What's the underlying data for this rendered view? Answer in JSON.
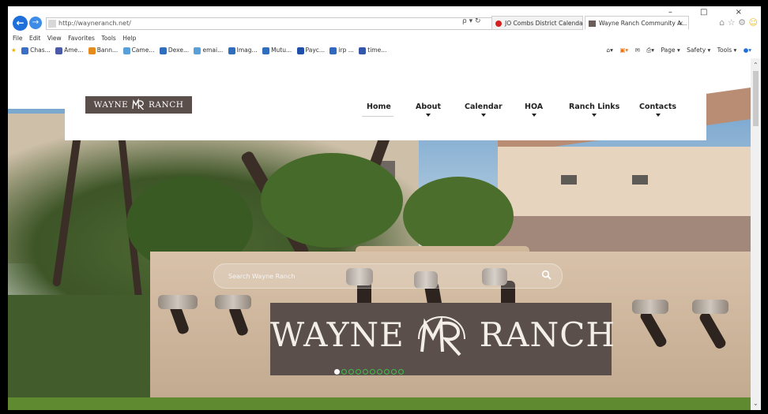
{
  "browser": {
    "address_url": "http://wayneranch.net/",
    "addr_tools": "ρ ▾ ↻",
    "tabs": [
      {
        "label": "JO Combs District Calendar",
        "active": false
      },
      {
        "label": "Wayne Ranch Community A...",
        "active": true,
        "close": "×"
      }
    ],
    "window_controls": "– □ ×",
    "menu": [
      "File",
      "Edit",
      "View",
      "Favorites",
      "Tools",
      "Help"
    ],
    "favorites": [
      "Chas...",
      "Ame...",
      "Bann...",
      "Came...",
      "Dexe...",
      "emai...",
      "Imag...",
      "Mutu...",
      "Payc...",
      "irp ...",
      "time..."
    ],
    "command_bar": [
      "Page ▾",
      "Safety ▾",
      "Tools ▾"
    ],
    "colors": {
      "accent": "#1e6fd9",
      "tab_red": "#d62020"
    }
  },
  "site": {
    "logo_left": "WAYNE",
    "logo_right": "RANCH",
    "nav": [
      {
        "label": "Home",
        "caret": false,
        "active": true
      },
      {
        "label": "About",
        "caret": true
      },
      {
        "label": "Calendar",
        "caret": true
      },
      {
        "label": "HOA",
        "caret": true
      },
      {
        "label": "Ranch Links",
        "caret": true
      },
      {
        "label": "Contacts",
        "caret": true
      }
    ],
    "search": {
      "placeholder": "Search Wayne Ranch"
    },
    "sign_left": "WAYNE",
    "sign_right": "RANCH",
    "slider": {
      "count": 10,
      "active_index": 0
    },
    "colors": {
      "brand": "#5b4f4b",
      "dot": "#3fbf4a"
    }
  }
}
